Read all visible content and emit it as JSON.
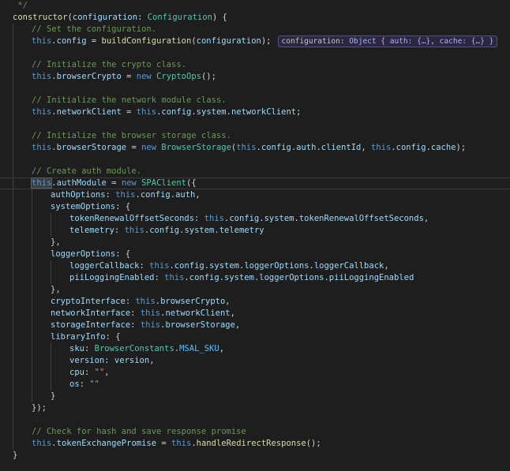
{
  "lines": [
    {
      "indent": 0,
      "tokens": [
        {
          "t": " */",
          "c": "cmt"
        }
      ]
    },
    {
      "indent": 0,
      "tokens": [
        {
          "t": "constructor",
          "c": "fn"
        },
        {
          "t": "(",
          "c": "punct"
        },
        {
          "t": "configuration",
          "c": "prop"
        },
        {
          "t": ": ",
          "c": "punct"
        },
        {
          "t": "Configuration",
          "c": "type"
        },
        {
          "t": ") {",
          "c": "punct"
        }
      ]
    },
    {
      "indent": 1,
      "tokens": [
        {
          "t": "// Set the configuration.",
          "c": "cmt"
        }
      ]
    },
    {
      "indent": 1,
      "tokens": [
        {
          "t": "this",
          "c": "this"
        },
        {
          "t": ".",
          "c": "punct"
        },
        {
          "t": "config",
          "c": "prop"
        },
        {
          "t": " = ",
          "c": "punct"
        },
        {
          "t": "buildConfiguration",
          "c": "fn"
        },
        {
          "t": "(",
          "c": "punct"
        },
        {
          "t": "configuration",
          "c": "prop"
        },
        {
          "t": ");",
          "c": "punct"
        }
      ],
      "hint": {
        "key": "configuration:",
        "value": "Object { auth: {…}, cache: {…} }"
      }
    },
    {
      "indent": 1,
      "tokens": []
    },
    {
      "indent": 1,
      "tokens": [
        {
          "t": "// Initialize the crypto class.",
          "c": "cmt"
        }
      ]
    },
    {
      "indent": 1,
      "tokens": [
        {
          "t": "this",
          "c": "this"
        },
        {
          "t": ".",
          "c": "punct"
        },
        {
          "t": "browserCrypto",
          "c": "prop"
        },
        {
          "t": " = ",
          "c": "punct"
        },
        {
          "t": "new ",
          "c": "kw"
        },
        {
          "t": "CryptoOps",
          "c": "type"
        },
        {
          "t": "();",
          "c": "punct"
        }
      ]
    },
    {
      "indent": 1,
      "tokens": []
    },
    {
      "indent": 1,
      "tokens": [
        {
          "t": "// Initialize the network module class.",
          "c": "cmt"
        }
      ]
    },
    {
      "indent": 1,
      "tokens": [
        {
          "t": "this",
          "c": "this"
        },
        {
          "t": ".",
          "c": "punct"
        },
        {
          "t": "networkClient",
          "c": "prop"
        },
        {
          "t": " = ",
          "c": "punct"
        },
        {
          "t": "this",
          "c": "this"
        },
        {
          "t": ".",
          "c": "punct"
        },
        {
          "t": "config",
          "c": "prop"
        },
        {
          "t": ".",
          "c": "punct"
        },
        {
          "t": "system",
          "c": "prop"
        },
        {
          "t": ".",
          "c": "punct"
        },
        {
          "t": "networkClient",
          "c": "prop"
        },
        {
          "t": ";",
          "c": "punct"
        }
      ]
    },
    {
      "indent": 1,
      "tokens": []
    },
    {
      "indent": 1,
      "tokens": [
        {
          "t": "// Initialize the browser storage class.",
          "c": "cmt"
        }
      ]
    },
    {
      "indent": 1,
      "tokens": [
        {
          "t": "this",
          "c": "this"
        },
        {
          "t": ".",
          "c": "punct"
        },
        {
          "t": "browserStorage",
          "c": "prop"
        },
        {
          "t": " = ",
          "c": "punct"
        },
        {
          "t": "new ",
          "c": "kw"
        },
        {
          "t": "BrowserStorage",
          "c": "type"
        },
        {
          "t": "(",
          "c": "punct"
        },
        {
          "t": "this",
          "c": "this"
        },
        {
          "t": ".",
          "c": "punct"
        },
        {
          "t": "config",
          "c": "prop"
        },
        {
          "t": ".",
          "c": "punct"
        },
        {
          "t": "auth",
          "c": "prop"
        },
        {
          "t": ".",
          "c": "punct"
        },
        {
          "t": "clientId",
          "c": "prop"
        },
        {
          "t": ", ",
          "c": "punct"
        },
        {
          "t": "this",
          "c": "this"
        },
        {
          "t": ".",
          "c": "punct"
        },
        {
          "t": "config",
          "c": "prop"
        },
        {
          "t": ".",
          "c": "punct"
        },
        {
          "t": "cache",
          "c": "prop"
        },
        {
          "t": ");",
          "c": "punct"
        }
      ]
    },
    {
      "indent": 1,
      "tokens": []
    },
    {
      "indent": 1,
      "tokens": [
        {
          "t": "// Create auth module.",
          "c": "cmt"
        }
      ]
    },
    {
      "indent": 1,
      "active": true,
      "tokens": [
        {
          "t": "this",
          "c": "this",
          "hl": true
        },
        {
          "t": ".",
          "c": "punct"
        },
        {
          "t": "authModule",
          "c": "prop"
        },
        {
          "t": " = ",
          "c": "punct"
        },
        {
          "t": "new ",
          "c": "kw"
        },
        {
          "t": "SPAClient",
          "c": "type"
        },
        {
          "t": "({",
          "c": "punct"
        }
      ]
    },
    {
      "indent": 2,
      "tokens": [
        {
          "t": "authOptions",
          "c": "prop"
        },
        {
          "t": ": ",
          "c": "punct"
        },
        {
          "t": "this",
          "c": "this"
        },
        {
          "t": ".",
          "c": "punct"
        },
        {
          "t": "config",
          "c": "prop"
        },
        {
          "t": ".",
          "c": "punct"
        },
        {
          "t": "auth",
          "c": "prop"
        },
        {
          "t": ",",
          "c": "punct"
        }
      ]
    },
    {
      "indent": 2,
      "tokens": [
        {
          "t": "systemOptions",
          "c": "prop"
        },
        {
          "t": ": {",
          "c": "punct"
        }
      ]
    },
    {
      "indent": 3,
      "tokens": [
        {
          "t": "tokenRenewalOffsetSeconds",
          "c": "prop"
        },
        {
          "t": ": ",
          "c": "punct"
        },
        {
          "t": "this",
          "c": "this"
        },
        {
          "t": ".",
          "c": "punct"
        },
        {
          "t": "config",
          "c": "prop"
        },
        {
          "t": ".",
          "c": "punct"
        },
        {
          "t": "system",
          "c": "prop"
        },
        {
          "t": ".",
          "c": "punct"
        },
        {
          "t": "tokenRenewalOffsetSeconds",
          "c": "prop"
        },
        {
          "t": ",",
          "c": "punct"
        }
      ]
    },
    {
      "indent": 3,
      "tokens": [
        {
          "t": "telemetry",
          "c": "prop"
        },
        {
          "t": ": ",
          "c": "punct"
        },
        {
          "t": "this",
          "c": "this"
        },
        {
          "t": ".",
          "c": "punct"
        },
        {
          "t": "config",
          "c": "prop"
        },
        {
          "t": ".",
          "c": "punct"
        },
        {
          "t": "system",
          "c": "prop"
        },
        {
          "t": ".",
          "c": "punct"
        },
        {
          "t": "telemetry",
          "c": "prop"
        }
      ]
    },
    {
      "indent": 2,
      "tokens": [
        {
          "t": "},",
          "c": "punct"
        }
      ]
    },
    {
      "indent": 2,
      "tokens": [
        {
          "t": "loggerOptions",
          "c": "prop"
        },
        {
          "t": ": {",
          "c": "punct"
        }
      ]
    },
    {
      "indent": 3,
      "tokens": [
        {
          "t": "loggerCallback",
          "c": "prop"
        },
        {
          "t": ": ",
          "c": "punct"
        },
        {
          "t": "this",
          "c": "this"
        },
        {
          "t": ".",
          "c": "punct"
        },
        {
          "t": "config",
          "c": "prop"
        },
        {
          "t": ".",
          "c": "punct"
        },
        {
          "t": "system",
          "c": "prop"
        },
        {
          "t": ".",
          "c": "punct"
        },
        {
          "t": "loggerOptions",
          "c": "prop"
        },
        {
          "t": ".",
          "c": "punct"
        },
        {
          "t": "loggerCallback",
          "c": "prop"
        },
        {
          "t": ",",
          "c": "punct"
        }
      ]
    },
    {
      "indent": 3,
      "tokens": [
        {
          "t": "piiLoggingEnabled",
          "c": "prop"
        },
        {
          "t": ": ",
          "c": "punct"
        },
        {
          "t": "this",
          "c": "this"
        },
        {
          "t": ".",
          "c": "punct"
        },
        {
          "t": "config",
          "c": "prop"
        },
        {
          "t": ".",
          "c": "punct"
        },
        {
          "t": "system",
          "c": "prop"
        },
        {
          "t": ".",
          "c": "punct"
        },
        {
          "t": "loggerOptions",
          "c": "prop"
        },
        {
          "t": ".",
          "c": "punct"
        },
        {
          "t": "piiLoggingEnabled",
          "c": "prop"
        }
      ]
    },
    {
      "indent": 2,
      "tokens": [
        {
          "t": "},",
          "c": "punct"
        }
      ]
    },
    {
      "indent": 2,
      "tokens": [
        {
          "t": "cryptoInterface",
          "c": "prop"
        },
        {
          "t": ": ",
          "c": "punct"
        },
        {
          "t": "this",
          "c": "this"
        },
        {
          "t": ".",
          "c": "punct"
        },
        {
          "t": "browserCrypto",
          "c": "prop"
        },
        {
          "t": ",",
          "c": "punct"
        }
      ]
    },
    {
      "indent": 2,
      "tokens": [
        {
          "t": "networkInterface",
          "c": "prop"
        },
        {
          "t": ": ",
          "c": "punct"
        },
        {
          "t": "this",
          "c": "this"
        },
        {
          "t": ".",
          "c": "punct"
        },
        {
          "t": "networkClient",
          "c": "prop"
        },
        {
          "t": ",",
          "c": "punct"
        }
      ]
    },
    {
      "indent": 2,
      "tokens": [
        {
          "t": "storageInterface",
          "c": "prop"
        },
        {
          "t": ": ",
          "c": "punct"
        },
        {
          "t": "this",
          "c": "this"
        },
        {
          "t": ".",
          "c": "punct"
        },
        {
          "t": "browserStorage",
          "c": "prop"
        },
        {
          "t": ",",
          "c": "punct"
        }
      ]
    },
    {
      "indent": 2,
      "tokens": [
        {
          "t": "libraryInfo",
          "c": "prop"
        },
        {
          "t": ": {",
          "c": "punct"
        }
      ]
    },
    {
      "indent": 3,
      "tokens": [
        {
          "t": "sku",
          "c": "prop"
        },
        {
          "t": ": ",
          "c": "punct"
        },
        {
          "t": "BrowserConstants",
          "c": "type"
        },
        {
          "t": ".",
          "c": "punct"
        },
        {
          "t": "MSAL_SKU",
          "c": "const"
        },
        {
          "t": ",",
          "c": "punct"
        }
      ]
    },
    {
      "indent": 3,
      "tokens": [
        {
          "t": "version",
          "c": "prop"
        },
        {
          "t": ": ",
          "c": "punct"
        },
        {
          "t": "version",
          "c": "prop"
        },
        {
          "t": ",",
          "c": "punct"
        }
      ]
    },
    {
      "indent": 3,
      "tokens": [
        {
          "t": "cpu",
          "c": "prop"
        },
        {
          "t": ": ",
          "c": "punct"
        },
        {
          "t": "\"\"",
          "c": "str"
        },
        {
          "t": ",",
          "c": "punct"
        }
      ]
    },
    {
      "indent": 3,
      "tokens": [
        {
          "t": "os",
          "c": "prop"
        },
        {
          "t": ": ",
          "c": "punct"
        },
        {
          "t": "\"\"",
          "c": "str"
        }
      ]
    },
    {
      "indent": 2,
      "tokens": [
        {
          "t": "}",
          "c": "punct"
        }
      ]
    },
    {
      "indent": 1,
      "tokens": [
        {
          "t": "});",
          "c": "punct"
        }
      ]
    },
    {
      "indent": 1,
      "tokens": []
    },
    {
      "indent": 1,
      "tokens": [
        {
          "t": "// Check for hash and save response promise",
          "c": "cmt"
        }
      ]
    },
    {
      "indent": 1,
      "tokens": [
        {
          "t": "this",
          "c": "this"
        },
        {
          "t": ".",
          "c": "punct"
        },
        {
          "t": "tokenExchangePromise",
          "c": "prop"
        },
        {
          "t": " = ",
          "c": "punct"
        },
        {
          "t": "this",
          "c": "this"
        },
        {
          "t": ".",
          "c": "punct"
        },
        {
          "t": "handleRedirectResponse",
          "c": "fn"
        },
        {
          "t": "();",
          "c": "punct"
        }
      ]
    },
    {
      "indent": 0,
      "tokens": [
        {
          "t": "}",
          "c": "punct"
        }
      ]
    }
  ]
}
